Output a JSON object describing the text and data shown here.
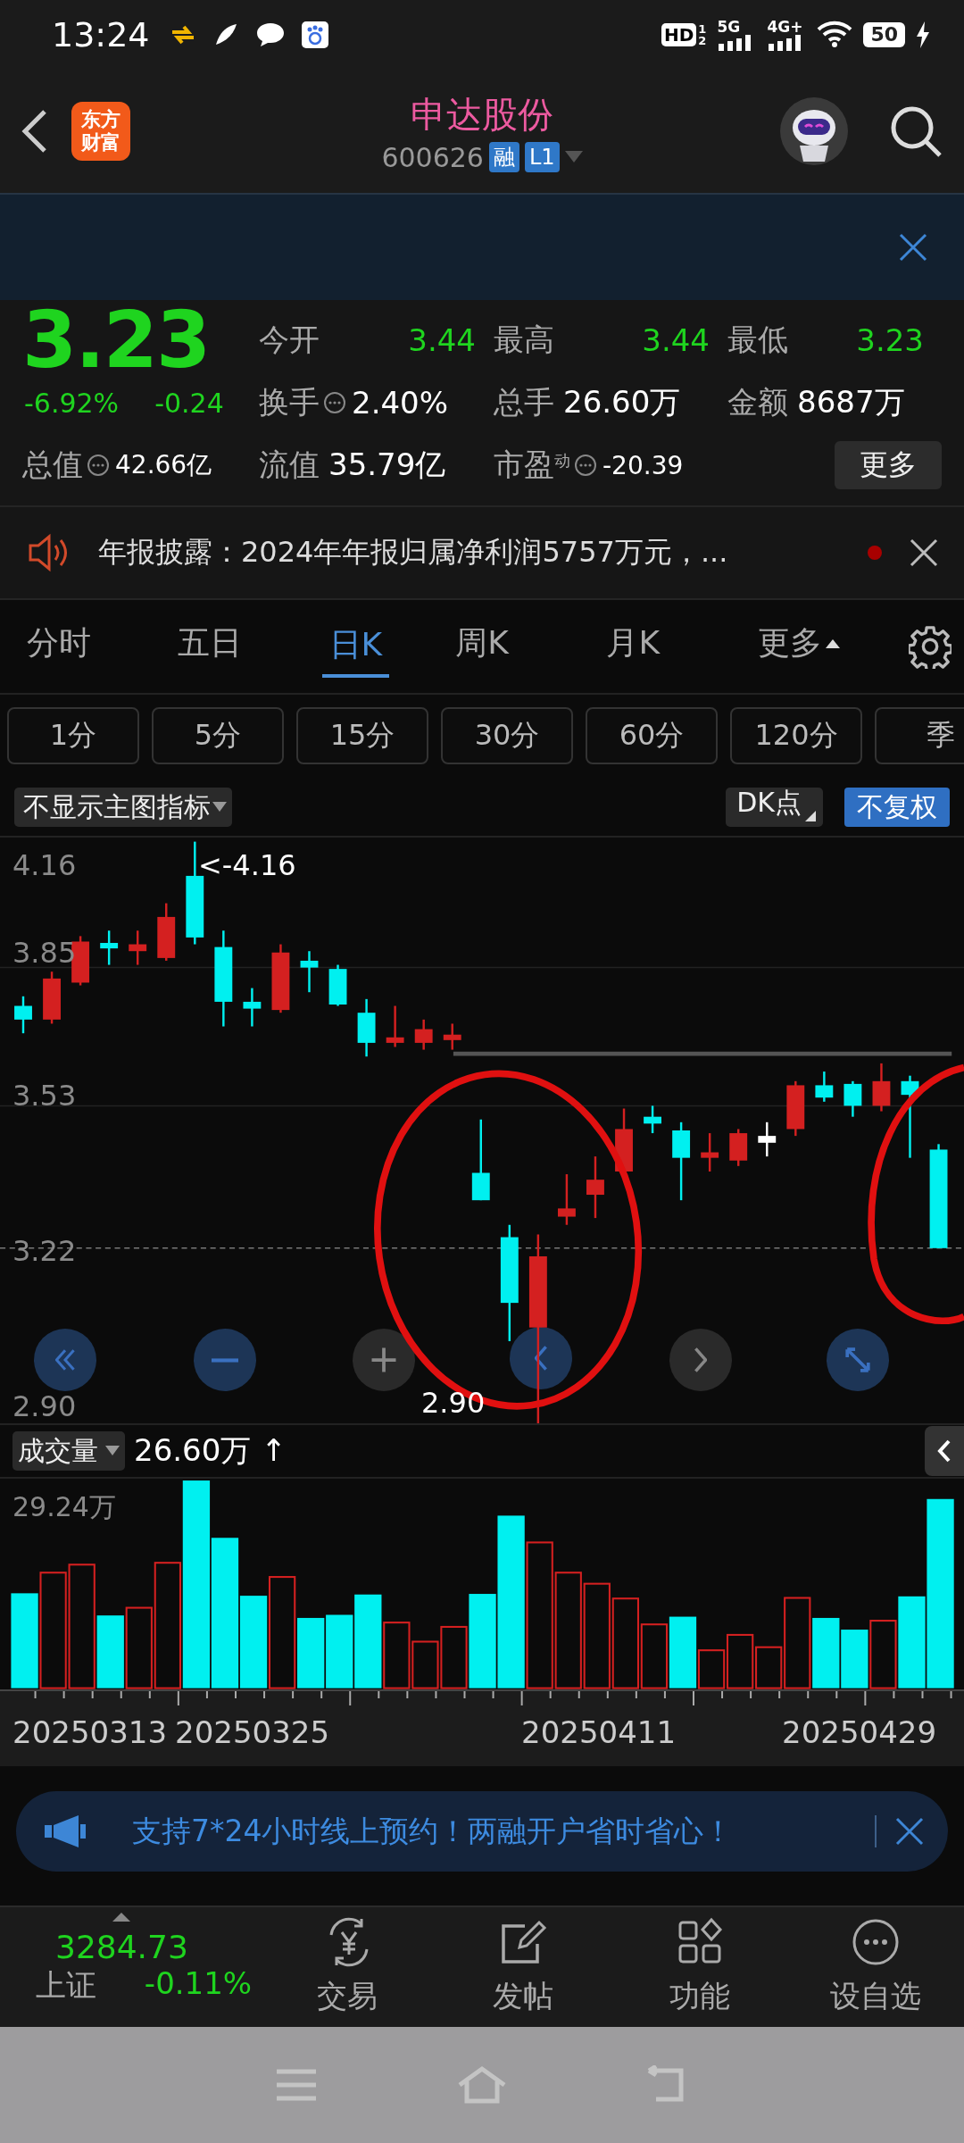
{
  "status_bar": {
    "time": "13:24",
    "hd": "HD",
    "sims": [
      "1",
      "2"
    ],
    "networks": [
      "5G",
      "4G+"
    ],
    "battery": "50"
  },
  "header": {
    "logo_lines": [
      "东方",
      "财富"
    ],
    "title": "申达股份",
    "code": "600626",
    "badges": [
      "融",
      "L1"
    ]
  },
  "quote": {
    "price": "3.23",
    "change_pct": "-6.92%",
    "change": "-0.24",
    "stats": [
      {
        "label": "今开",
        "value": "3.44",
        "kind": "price"
      },
      {
        "label": "最高",
        "value": "3.44",
        "kind": "price"
      },
      {
        "label": "最低",
        "value": "3.23",
        "kind": "price"
      },
      {
        "label": "换手",
        "value": "2.40%",
        "kind": "amount",
        "info": true
      },
      {
        "label": "总手",
        "value": "26.60万",
        "kind": "amount"
      },
      {
        "label": "金额",
        "value": "8687万",
        "kind": "amount"
      },
      {
        "label": "总值",
        "value": "42.66亿",
        "kind": "small",
        "info": true
      },
      {
        "label": "流值",
        "value": "35.79亿",
        "kind": "amount"
      },
      {
        "label": "市盈",
        "sup": "动",
        "value": "-20.39",
        "kind": "small",
        "info": true
      }
    ],
    "more_button": "更多"
  },
  "notice": {
    "text": "年报披露：2024年年报归属净利润5757万元，...",
    "unread": true
  },
  "tabs": [
    {
      "label": "分时",
      "selected": false
    },
    {
      "label": "五日",
      "selected": false
    },
    {
      "label": "日K",
      "selected": true
    },
    {
      "label": "周K",
      "selected": false
    },
    {
      "label": "月K",
      "selected": false
    },
    {
      "label": "更多",
      "selected": false,
      "kind": "menu"
    }
  ],
  "periods": [
    "1分",
    "5分",
    "15分",
    "30分",
    "60分",
    "120分",
    "季"
  ],
  "indicators": {
    "main": "不显示主图指标",
    "dk": "DK点",
    "adjust": {
      "label": "不复权",
      "selected": true
    }
  },
  "price_chart": {
    "axis_labels": [
      "4.16",
      "3.85",
      "3.53",
      "3.22",
      "2.90"
    ],
    "high_marker": "<-4.16",
    "low_marker": "2.90"
  },
  "volume": {
    "indicator": "成交量",
    "value": "26.60万 ↑",
    "max_label": "29.24万",
    "dates": [
      "20250313",
      "20250325",
      "20250411",
      "20250429"
    ]
  },
  "ad": {
    "text": "支持7*24小时线上预约！两融开户省时省心！"
  },
  "bottom_nav": {
    "index": {
      "value": "3284.73",
      "name": "上证",
      "change": "-0.11%"
    },
    "items": [
      {
        "label": "交易",
        "kind": "trade"
      },
      {
        "label": "发帖",
        "kind": "post"
      },
      {
        "label": "功能",
        "kind": "apps"
      },
      {
        "label": "设自选",
        "kind": "watch"
      }
    ]
  }
}
